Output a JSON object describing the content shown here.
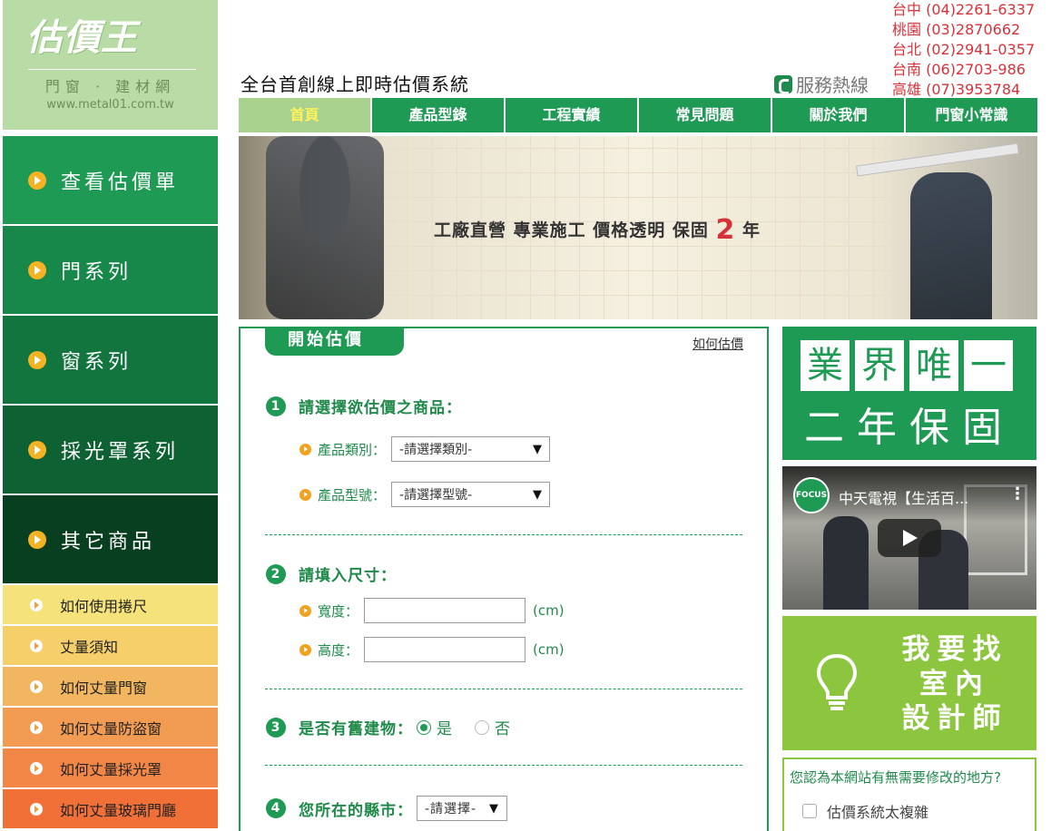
{
  "logo": {
    "brand": "估價王",
    "tagline": "門窗 · 建材網",
    "url": "www.metal01.com.tw"
  },
  "header": {
    "title": "全台首創線上即時估價系統",
    "hotline_label": "服務熱線",
    "phones": [
      "台中 (04)2261-6337",
      "桃園 (03)2870662",
      "台北 (02)2941-0357",
      "台南 (06)2703-986",
      "高雄 (07)3953784"
    ]
  },
  "topnav": [
    "首頁",
    "產品型錄",
    "工程實績",
    "常見問題",
    "關於我們",
    "門窗小常識"
  ],
  "banner": {
    "slogan": "工廠直營 專業施工 價格透明 保固",
    "years": "2",
    "suffix": "年"
  },
  "sidebar": {
    "main": [
      {
        "label": "查看估價單",
        "color": "#1f9a54"
      },
      {
        "label": "門系列",
        "color": "#18884a"
      },
      {
        "label": "窗系列",
        "color": "#12753e"
      },
      {
        "label": "採光罩系列",
        "color": "#0d6133"
      },
      {
        "label": "其它商品",
        "color": "#083f21"
      }
    ],
    "guides": [
      {
        "label": "如何使用捲尺",
        "color": "#f5e27a"
      },
      {
        "label": "丈量須知",
        "color": "#f5cf6a"
      },
      {
        "label": "如何丈量門窗",
        "color": "#f3b660"
      },
      {
        "label": "如何丈量防盜窗",
        "color": "#f29c53"
      },
      {
        "label": "如何丈量採光罩",
        "color": "#f18646"
      },
      {
        "label": "如何丈量玻璃門廳",
        "color": "#f07038"
      }
    ]
  },
  "form": {
    "tab": "開始估價",
    "howto": "如何估價",
    "q1": {
      "num": "1",
      "title": "請選擇欲估價之商品：",
      "category_label": "產品類別：",
      "category_value": "-請選擇類別-",
      "model_label": "產品型號：",
      "model_value": "-請選擇型號-"
    },
    "q2": {
      "num": "2",
      "title": "請填入尺寸：",
      "width_label": "寬度：",
      "height_label": "高度：",
      "unit": "(cm)"
    },
    "q3": {
      "num": "3",
      "title": "是否有舊建物：",
      "yes": "是",
      "no": "否"
    },
    "q4": {
      "num": "4",
      "title": "您所在的縣市：",
      "city_value": "-請選擇-"
    }
  },
  "right": {
    "promo1_top": [
      "業",
      "界",
      "唯",
      "一"
    ],
    "promo1_bottom": "二年保固",
    "video_title": "中天電視【生活百...",
    "video_logo": "FOCUS",
    "promo2": [
      "我要找",
      "室內",
      "設計師"
    ],
    "survey_question": "您認為本網站有無需要修改的地方?",
    "survey_option": "估價系統太複雜"
  }
}
